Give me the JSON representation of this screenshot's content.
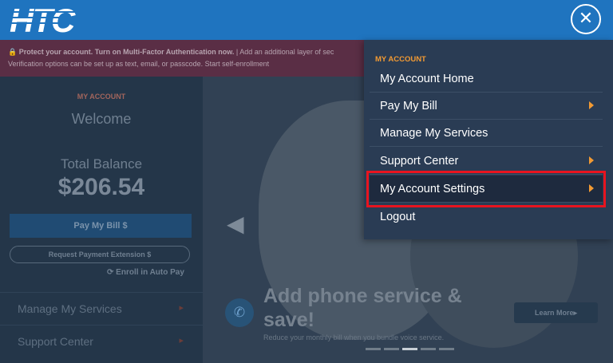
{
  "header": {
    "logo_text": "HTC",
    "close_icon": "close-icon"
  },
  "alert": {
    "bold_text": "Protect your account. Turn on Multi-Factor Authentication now.",
    "text_line1": " | Add an additional layer of sec",
    "text_line2": "Verification options can be set up as text, email, or passcode. Start self-enrollment"
  },
  "left_panel": {
    "section_label": "MY ACCOUNT",
    "welcome": "Welcome",
    "total_balance_label": "Total Balance",
    "total_balance_value": "$206.54",
    "pay_button": "Pay My Bill $",
    "extension_button": "Request Payment Extension $",
    "autopay_link": "Enroll in Auto Pay",
    "nav_items": [
      {
        "label": "Manage My Services"
      },
      {
        "label": "Support Center"
      }
    ]
  },
  "hero": {
    "title": "Add phone service & save!",
    "subtitle": "Reduce your monthly bill when you bundle voice service.",
    "learn_more": "Learn More",
    "slide_count": 5,
    "active_slide": 3
  },
  "menu": {
    "section_label": "MY ACCOUNT",
    "items": [
      {
        "label": "My Account Home",
        "has_submenu": false
      },
      {
        "label": "Pay My Bill",
        "has_submenu": true
      },
      {
        "label": "Manage My Services",
        "has_submenu": false
      },
      {
        "label": "Support Center",
        "has_submenu": true
      },
      {
        "label": "My Account Settings",
        "has_submenu": true,
        "highlighted": true
      },
      {
        "label": "Logout",
        "has_submenu": false
      }
    ]
  },
  "colors": {
    "header_blue": "#1f74bf",
    "menu_bg": "#2a3c54",
    "accent_orange": "#f29a33",
    "highlight_red": "#e8141f"
  }
}
